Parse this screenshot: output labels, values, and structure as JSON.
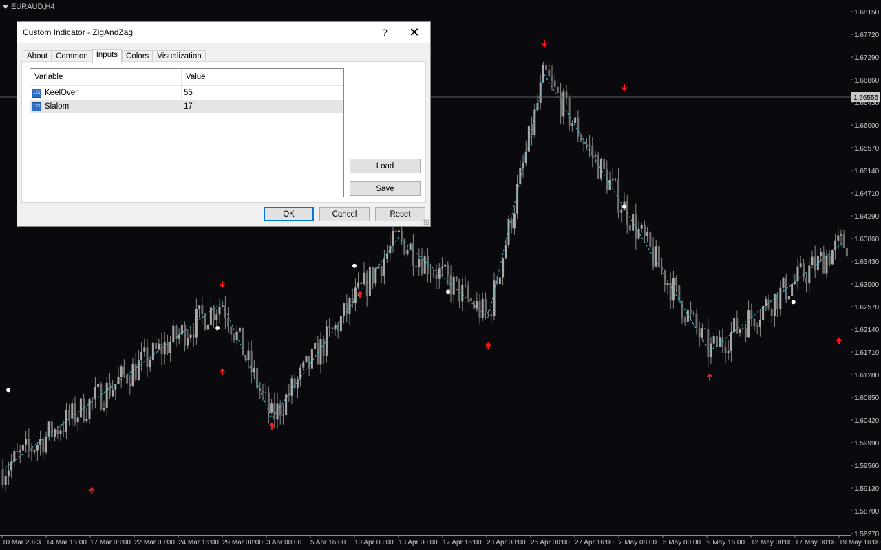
{
  "chart_window": {
    "symbol_label": "EURAUD,H4",
    "current_price": "1.66555",
    "colors": {
      "background": "#0a0a0e",
      "candles": "#8c8c8c",
      "zigzag": "#3ec6d4",
      "arrows": "#ff1a1a",
      "dots": "#ffffff"
    }
  },
  "chart_data": {
    "type": "line",
    "title": "",
    "xlabel": "",
    "ylabel": "",
    "ylim": [
      1.5825,
      1.6859
    ],
    "y_ticks": [
      "1.68150",
      "1.67720",
      "1.67290",
      "1.66860",
      "1.66430",
      "1.66000",
      "1.65570",
      "1.65140",
      "1.64710",
      "1.64290",
      "1.63860",
      "1.63430",
      "1.63000",
      "1.62570",
      "1.62140",
      "1.61710",
      "1.61280",
      "1.60850",
      "1.60420",
      "1.59990",
      "1.59560",
      "1.59130",
      "1.58700",
      "1.58270"
    ],
    "x_ticks": [
      "10 Mar 2023",
      "14 Mar 16:00",
      "17 Mar 08:00",
      "22 Mar 00:00",
      "24 Mar 16:00",
      "29 Mar 08:00",
      "3 Apr 00:00",
      "5 Apr 16:00",
      "10 Apr 08:00",
      "13 Apr 00:00",
      "17 Apr 16:00",
      "20 Apr 08:00",
      "25 Apr 00:00",
      "27 Apr 16:00",
      "2 May 08:00",
      "5 May 00:00",
      "9 May 16:00",
      "12 May 08:00",
      "17 May 00:00",
      "19 May 16:00"
    ],
    "zigzag": [
      {
        "x": "10 Mar 00:00",
        "y": 1.595
      },
      {
        "x": "29 Mar 08:00",
        "y": 1.6275
      },
      {
        "x": "3 Apr 08:00",
        "y": 1.605
      },
      {
        "x": "13 Apr 00:00",
        "y": 1.64
      },
      {
        "x": "20 Apr 12:00",
        "y": 1.6245
      },
      {
        "x": "25 Apr 20:00",
        "y": 1.6715
      },
      {
        "x": "9 May 20:00",
        "y": 1.618
      },
      {
        "x": "19 May 20:00",
        "y": 1.6388
      }
    ],
    "down_arrows": [
      {
        "x": "29 Mar 08:00",
        "y": 1.631
      },
      {
        "x": "25 Apr 20:00",
        "y": 1.6775
      },
      {
        "x": "2 May 16:00",
        "y": 1.669
      }
    ],
    "up_arrows": [
      {
        "x": "17 Mar 12:00",
        "y": 1.591
      },
      {
        "x": "29 Mar 08:00",
        "y": 1.614
      },
      {
        "x": "3 Apr 08:00",
        "y": 1.6035
      },
      {
        "x": "10 Apr 16:00",
        "y": 1.629
      },
      {
        "x": "20 Apr 12:00",
        "y": 1.619
      },
      {
        "x": "9 May 20:00",
        "y": 1.613
      },
      {
        "x": "19 May 16:00",
        "y": 1.62
      }
    ],
    "dots": [
      {
        "x": "10 Mar 16:00",
        "y": 1.6105
      },
      {
        "x": "28 Mar 20:00",
        "y": 1.6225
      },
      {
        "x": "10 Apr 08:00",
        "y": 1.6345
      },
      {
        "x": "18 Apr 00:00",
        "y": 1.6295
      },
      {
        "x": "2 May 16:00",
        "y": 1.646
      },
      {
        "x": "16 May 20:00",
        "y": 1.6275
      }
    ]
  },
  "dialog": {
    "title": "Custom Indicator - ZigAndZag",
    "help": "?",
    "close": "✕",
    "tabs": [
      "About",
      "Common",
      "Inputs",
      "Colors",
      "Visualization"
    ],
    "active_tab": "Inputs",
    "grid": {
      "headers": [
        "Variable",
        "Value"
      ],
      "rows": [
        {
          "icon": "123",
          "variable": "KeelOver",
          "value": "55"
        },
        {
          "icon": "123",
          "variable": "Slalom",
          "value": "17"
        }
      ]
    },
    "buttons": {
      "load": "Load",
      "save": "Save",
      "ok": "OK",
      "cancel": "Cancel",
      "reset": "Reset"
    }
  }
}
